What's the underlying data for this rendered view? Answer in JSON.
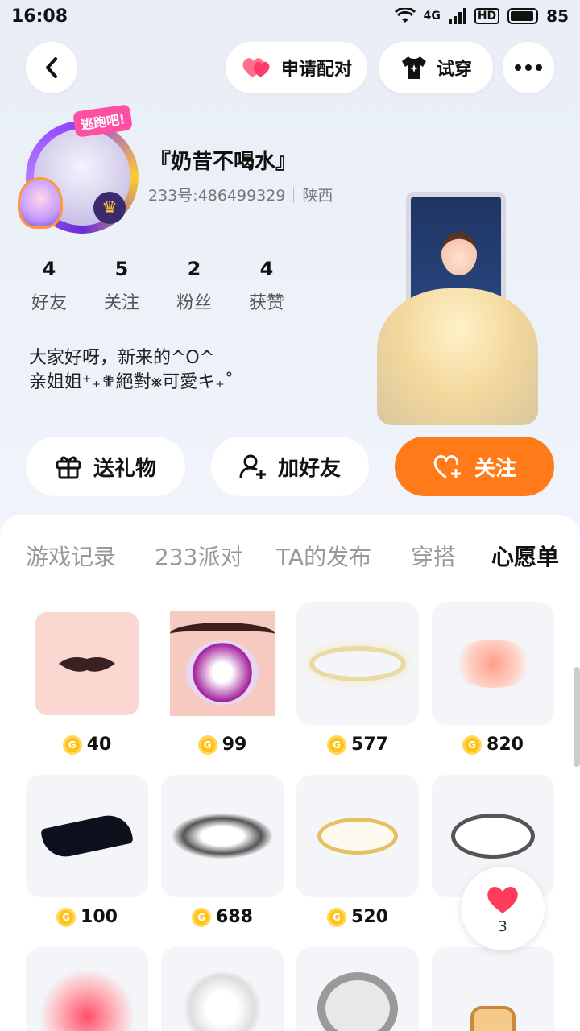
{
  "status": {
    "time": "16:08",
    "network": "4G",
    "hd": "HD",
    "battery": "85"
  },
  "header": {
    "back_icon": "chevron-left-icon",
    "pair_label": "申请配对",
    "try_label": "试穿",
    "more_icon": "ellipsis-icon"
  },
  "profile": {
    "avatar_badge": "逃跑吧!",
    "name": "『奶昔不喝水』",
    "id_text": "233号:486499329",
    "location": "陕西",
    "stats": [
      {
        "num": "4",
        "label": "好友"
      },
      {
        "num": "5",
        "label": "关注"
      },
      {
        "num": "2",
        "label": "粉丝"
      },
      {
        "num": "4",
        "label": "获赞"
      }
    ],
    "bio_line1": "大家好呀，新来的^O^",
    "bio_line2": "亲姐姐⁺₊✟絕對⨳可愛キ₊˚"
  },
  "actions": {
    "gift": "送礼物",
    "add_friend": "加好友",
    "follow": "关注"
  },
  "tabs": [
    {
      "label": "游戏记录",
      "active": false
    },
    {
      "label": "233派对",
      "active": false
    },
    {
      "label": "TA的发布",
      "active": false
    },
    {
      "label": "穿搭",
      "active": false
    },
    {
      "label": "心愿单",
      "active": true
    }
  ],
  "wishlist": [
    {
      "item": "mouth",
      "price": "40"
    },
    {
      "item": "eye",
      "price": "99"
    },
    {
      "item": "gold-halo",
      "price": "577"
    },
    {
      "item": "pink-star-effect",
      "price": "820"
    },
    {
      "item": "black-eye-mask",
      "price": "100"
    },
    {
      "item": "dark-magic-circle",
      "price": "688"
    },
    {
      "item": "gold-magic-circle",
      "price": "520"
    },
    {
      "item": "silver-pentagram-circle",
      "price": ""
    },
    {
      "item": "red-magic-circle",
      "price": ""
    },
    {
      "item": "white-flower",
      "price": ""
    },
    {
      "item": "silver-ring",
      "price": ""
    },
    {
      "item": "toast-bread",
      "price": ""
    }
  ],
  "float_like": {
    "count": "3"
  },
  "colors": {
    "accent": "#ff7a18",
    "like": "#ff3b5c",
    "coin": "#ffc21a"
  }
}
